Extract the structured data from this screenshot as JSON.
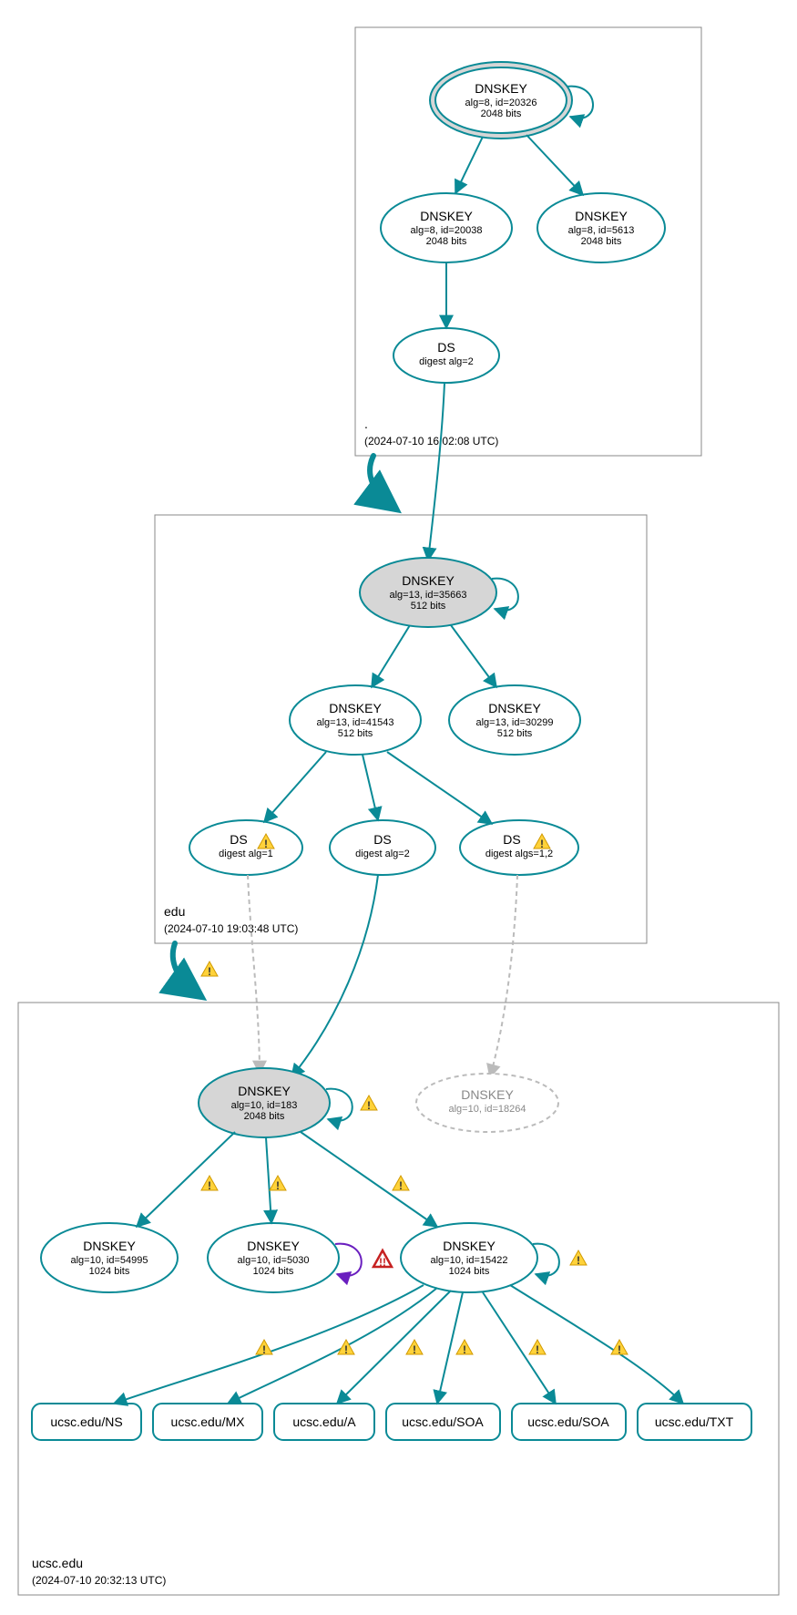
{
  "colors": {
    "teal": "#0a8a96",
    "ksk_fill": "#d6d6d6",
    "warn_fill": "#ffd23a",
    "warn_stroke": "#d19a00",
    "err": "#c62121",
    "purple": "#6a1fbf"
  },
  "zones": {
    "root": {
      "label": ".",
      "timestamp": "(2024-07-10 16:02:08 UTC)"
    },
    "edu": {
      "label": "edu",
      "timestamp": "(2024-07-10 19:03:48 UTC)"
    },
    "ucsc": {
      "label": "ucsc.edu",
      "timestamp": "(2024-07-10 20:32:13 UTC)"
    }
  },
  "nodes": {
    "root_ksk": {
      "title": "DNSKEY",
      "line2": "alg=8, id=20326",
      "line3": "2048 bits"
    },
    "root_zsk1": {
      "title": "DNSKEY",
      "line2": "alg=8, id=20038",
      "line3": "2048 bits"
    },
    "root_zsk2": {
      "title": "DNSKEY",
      "line2": "alg=8, id=5613",
      "line3": "2048 bits"
    },
    "root_ds": {
      "title": "DS",
      "line2": "digest alg=2"
    },
    "edu_ksk": {
      "title": "DNSKEY",
      "line2": "alg=13, id=35663",
      "line3": "512 bits"
    },
    "edu_zsk1": {
      "title": "DNSKEY",
      "line2": "alg=13, id=41543",
      "line3": "512 bits"
    },
    "edu_zsk2": {
      "title": "DNSKEY",
      "line2": "alg=13, id=30299",
      "line3": "512 bits"
    },
    "edu_ds1": {
      "title": "DS",
      "line2": "digest alg=1"
    },
    "edu_ds2": {
      "title": "DS",
      "line2": "digest alg=2"
    },
    "edu_ds3": {
      "title": "DS",
      "line2": "digest algs=1,2"
    },
    "ucsc_ksk": {
      "title": "DNSKEY",
      "line2": "alg=10, id=183",
      "line3": "2048 bits"
    },
    "ucsc_ghost": {
      "title": "DNSKEY",
      "line2": "alg=10, id=18264"
    },
    "ucsc_zsk1": {
      "title": "DNSKEY",
      "line2": "alg=10, id=54995",
      "line3": "1024 bits"
    },
    "ucsc_zsk2": {
      "title": "DNSKEY",
      "line2": "alg=10, id=5030",
      "line3": "1024 bits"
    },
    "ucsc_zsk3": {
      "title": "DNSKEY",
      "line2": "alg=10, id=15422",
      "line3": "1024 bits"
    }
  },
  "rrsets": {
    "ns": "ucsc.edu/NS",
    "mx": "ucsc.edu/MX",
    "a": "ucsc.edu/A",
    "soa1": "ucsc.edu/SOA",
    "soa2": "ucsc.edu/SOA",
    "txt": "ucsc.edu/TXT"
  }
}
